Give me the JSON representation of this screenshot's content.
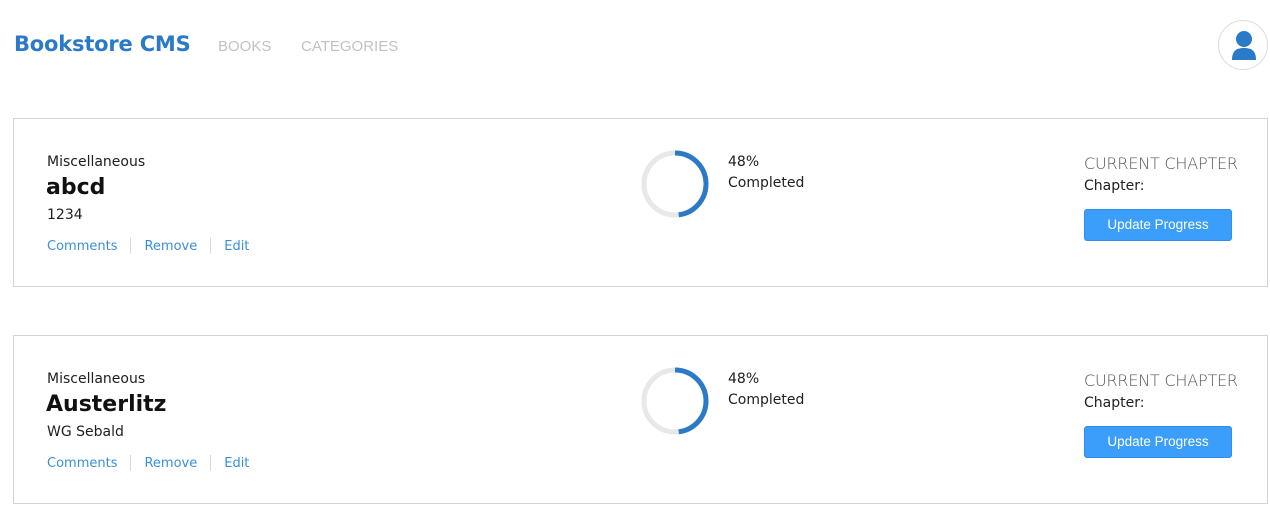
{
  "header": {
    "brand": "Bookstore CMS",
    "nav": {
      "books": "BOOKS",
      "categories": "CATEGORIES"
    },
    "accent_color": "#2b7ac8"
  },
  "books": [
    {
      "genre": "Miscellaneous",
      "title": "abcd",
      "author": "1234",
      "actions": {
        "comments": "Comments",
        "remove": "Remove",
        "edit": "Edit"
      },
      "progress_percent": 48,
      "percent_label": "48%",
      "completed_label": "Completed",
      "chapter_heading": "CURRENT CHAPTER",
      "chapter_label": "Chapter:",
      "update_button": "Update Progress"
    },
    {
      "genre": "Miscellaneous",
      "title": "Austerlitz",
      "author": "WG Sebald",
      "actions": {
        "comments": "Comments",
        "remove": "Remove",
        "edit": "Edit"
      },
      "progress_percent": 48,
      "percent_label": "48%",
      "completed_label": "Completed",
      "chapter_heading": "CURRENT CHAPTER",
      "chapter_label": "Chapter:",
      "update_button": "Update Progress"
    }
  ],
  "icons": {
    "avatar": "user-icon"
  },
  "colors": {
    "progress": "#2b7ac8",
    "progress_track": "#e8e8e8",
    "button": "#3a9efa",
    "link": "#3a8fd9"
  }
}
